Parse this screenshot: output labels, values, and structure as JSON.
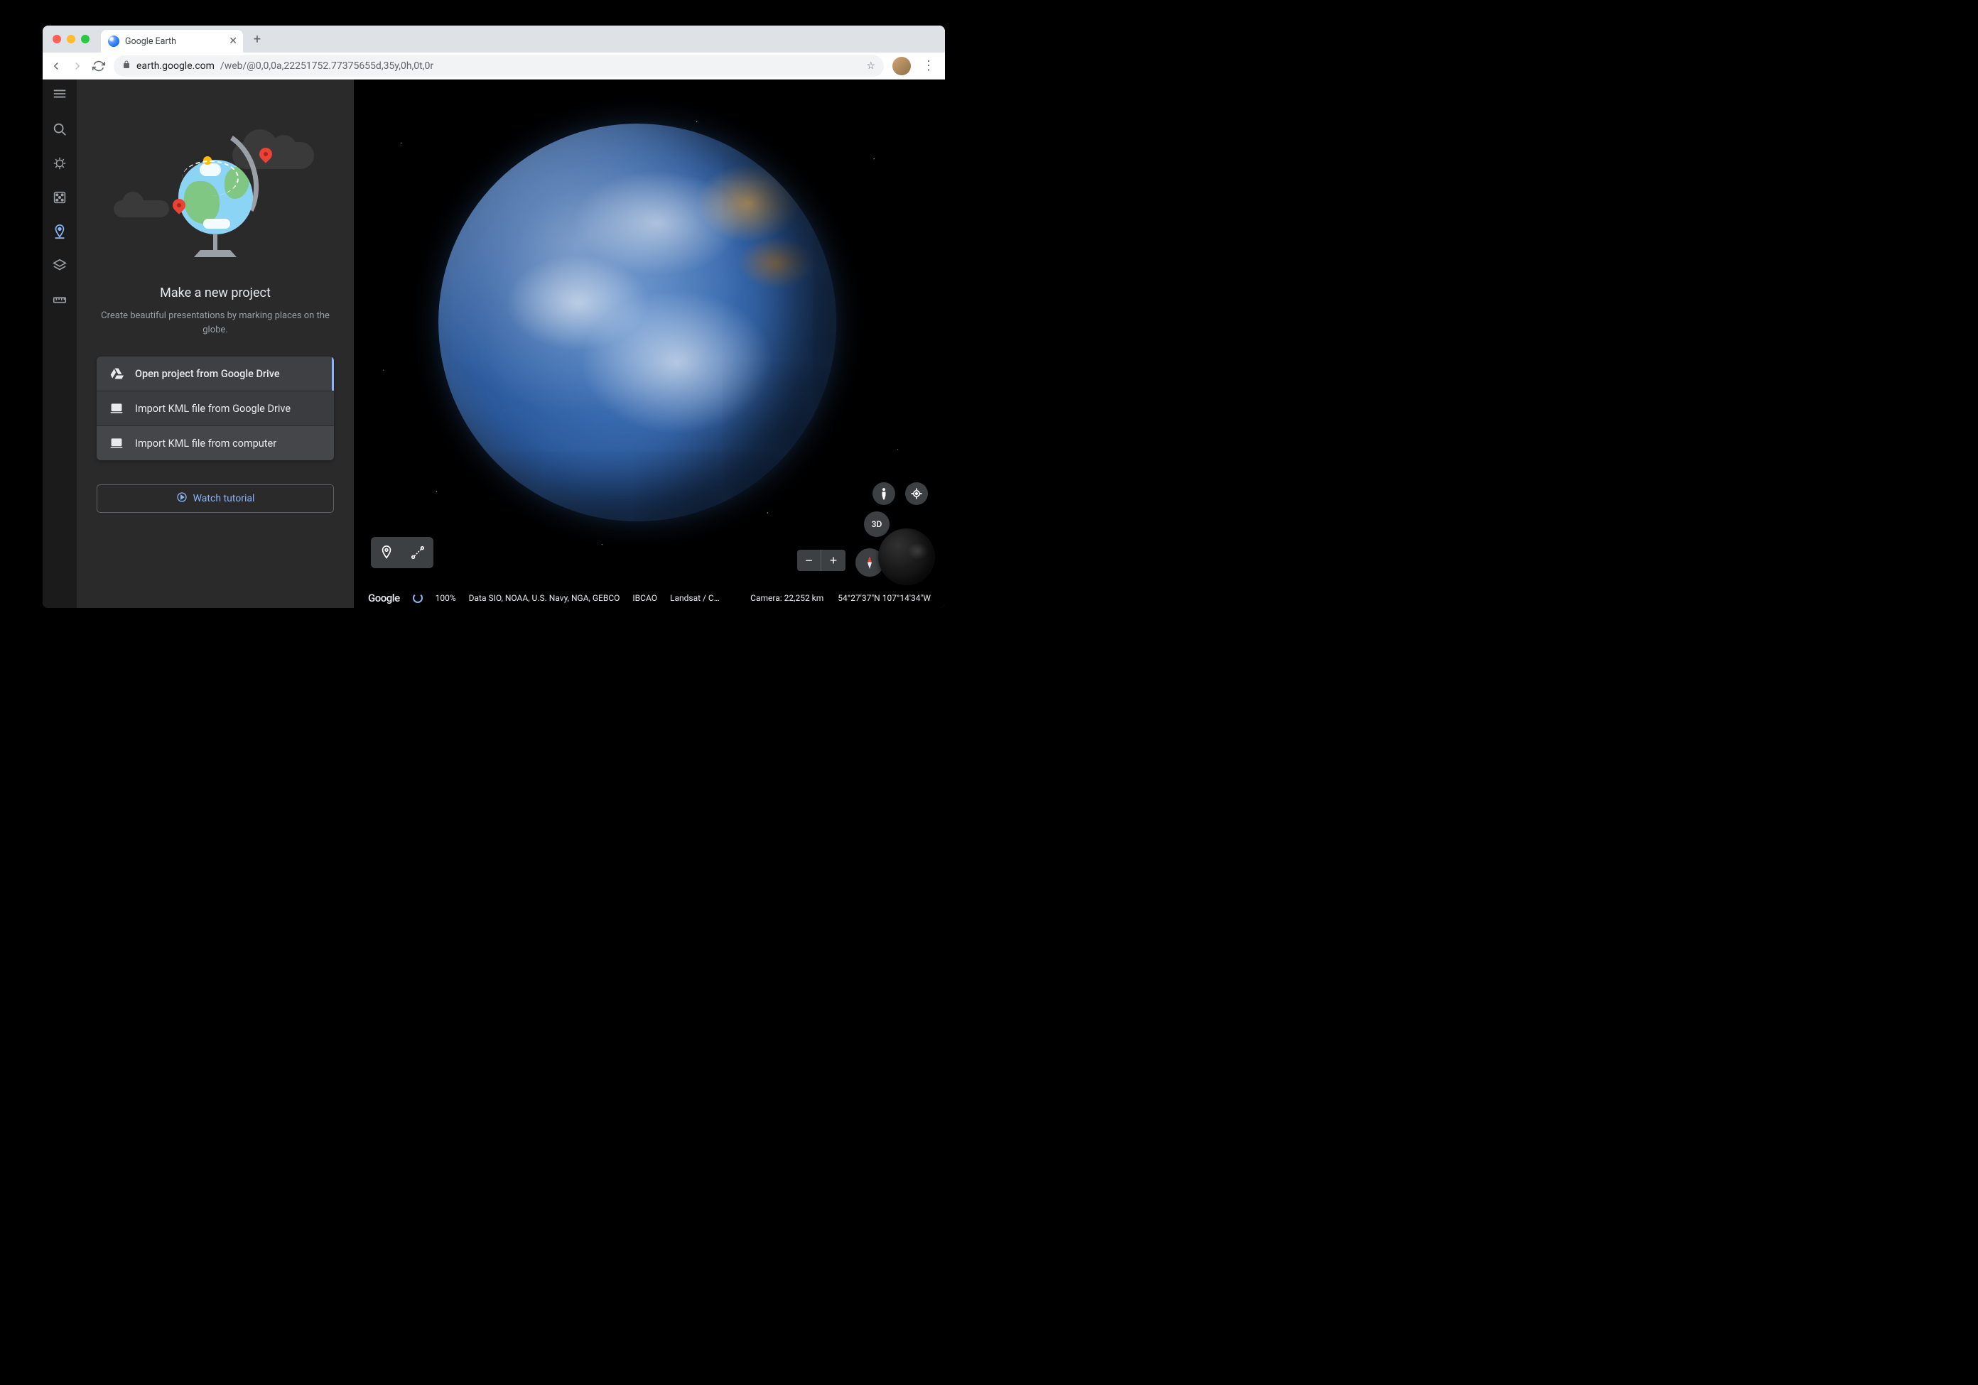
{
  "browser": {
    "tab_title": "Google Earth",
    "url_domain": "earth.google.com",
    "url_path": "/web/@0,0,0a,22251752.77375655d,35y,0h,0t,0r"
  },
  "panel": {
    "title": "Make a new project",
    "subtitle": "Create beautiful presentations by marking places on the globe.",
    "options": [
      {
        "label": "Open project from Google Drive"
      },
      {
        "label": "Import KML file from Google Drive"
      },
      {
        "label": "Import KML file from computer"
      }
    ],
    "tutorial": "Watch tutorial"
  },
  "status": {
    "brand": "Google",
    "loading_pct": "100%",
    "attribution_1": "Data SIO, NOAA, U.S. Navy, NGA, GEBCO",
    "attribution_2": "IBCAO",
    "attribution_3": "Landsat / C…",
    "camera": "Camera: 22,252 km",
    "coords": "54°27'37\"N 107°14'34\"W"
  },
  "controls": {
    "view_mode": "3D"
  }
}
